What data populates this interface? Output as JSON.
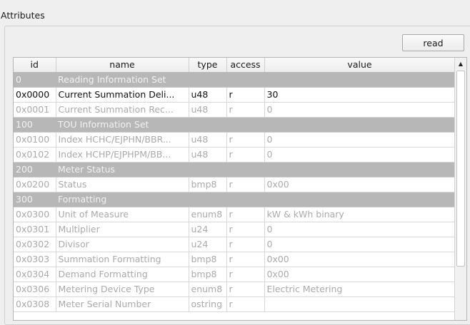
{
  "group": {
    "title": "Attributes"
  },
  "toolbar": {
    "read_label": "read"
  },
  "table": {
    "headers": [
      "id",
      "name",
      "type",
      "access",
      "value"
    ],
    "rows": [
      {
        "kind": "section",
        "id": "0",
        "name": "Reading Information Set"
      },
      {
        "kind": "attr",
        "active": true,
        "id": "0x0000",
        "name": "Current Summation Deli...",
        "type": "u48",
        "access": "r",
        "value": "30"
      },
      {
        "kind": "attr",
        "active": false,
        "id": "0x0001",
        "name": "Current Summation Rec...",
        "type": "u48",
        "access": "r",
        "value": "0"
      },
      {
        "kind": "section",
        "id": "100",
        "name": "TOU Information Set"
      },
      {
        "kind": "attr",
        "active": false,
        "id": "0x0100",
        "name": "Index HCHC/EJPHN/BBR...",
        "type": "u48",
        "access": "r",
        "value": "0"
      },
      {
        "kind": "attr",
        "active": false,
        "id": "0x0102",
        "name": "Index HCHP/EJPHPM/BB...",
        "type": "u48",
        "access": "r",
        "value": "0"
      },
      {
        "kind": "section",
        "id": "200",
        "name": "Meter Status"
      },
      {
        "kind": "attr",
        "active": false,
        "id": "0x0200",
        "name": "Status",
        "type": "bmp8",
        "access": "r",
        "value": "0x00"
      },
      {
        "kind": "section",
        "id": "300",
        "name": "Formatting"
      },
      {
        "kind": "attr",
        "active": false,
        "id": "0x0300",
        "name": "Unit of Measure",
        "type": "enum8",
        "access": "r",
        "value": "kW & kWh binary"
      },
      {
        "kind": "attr",
        "active": false,
        "id": "0x0301",
        "name": "Multiplier",
        "type": "u24",
        "access": "r",
        "value": "0"
      },
      {
        "kind": "attr",
        "active": false,
        "id": "0x0302",
        "name": "Divisor",
        "type": "u24",
        "access": "r",
        "value": "0"
      },
      {
        "kind": "attr",
        "active": false,
        "id": "0x0303",
        "name": "Summation Formatting",
        "type": "bmp8",
        "access": "r",
        "value": "0x00"
      },
      {
        "kind": "attr",
        "active": false,
        "id": "0x0304",
        "name": "Demand Formatting",
        "type": "bmp8",
        "access": "r",
        "value": "0x00"
      },
      {
        "kind": "attr",
        "active": false,
        "id": "0x0306",
        "name": "Metering Device Type",
        "type": "enum8",
        "access": "r",
        "value": "Electric Metering"
      },
      {
        "kind": "attr",
        "active": false,
        "id": "0x0308",
        "name": "Meter Serial Number",
        "type": "ostring",
        "access": "r",
        "value": ""
      }
    ]
  },
  "scrollbar": {
    "up_icon": "scroll-up-arrow-icon",
    "position": 0
  },
  "colors": {
    "section_bg": "#b7b7b7",
    "section_text": "#f2f2f2",
    "disabled_text": "#ababab",
    "active_text": "#111111"
  }
}
